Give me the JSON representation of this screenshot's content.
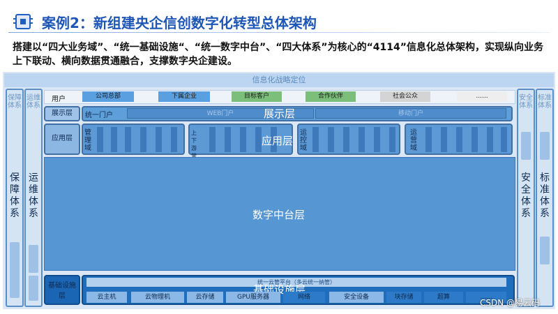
{
  "header": {
    "title": "案例2：新组建央企信创数字化转型总体架构",
    "description": "搭建以“四大业务域”、“统一基础设施“、“统一数字中台”、“四大体系”为核心的“4114”信息化总体架构，实现纵向业务上下联动、横向数据贯通融合，支撑数字央企建设。"
  },
  "banner": "信息化战略定位",
  "left_systems": [
    {
      "faint_label": "保障体系",
      "label": "保障体系"
    },
    {
      "faint_label": "运维体系",
      "label": "运维体系"
    }
  ],
  "right_systems": [
    {
      "faint_label": "安全体系",
      "label": "安全体系"
    },
    {
      "faint_label": "标准体系",
      "label": "标准体系"
    }
  ],
  "users": {
    "label": "用户",
    "items": [
      "公司总部",
      "下属企业",
      "目标客户",
      "合作伙伴",
      "社会公众",
      "......"
    ],
    "colors": [
      "#5a9fe0",
      "#5a9fe0",
      "#7bbf7a",
      "#7bbf7a",
      "#d4d4d4",
      "#eeeeee"
    ]
  },
  "presentation": {
    "label": "展示层",
    "portal": "统一门户",
    "web": "WEB门户",
    "mobile": "移动门户",
    "overlay": "展示层"
  },
  "application": {
    "label": "应用层",
    "overlay": "应用层",
    "domains": [
      "管理域",
      "上下游营销域",
      "运控域",
      "运营域"
    ]
  },
  "data_layer": "数字中台层",
  "infrastructure": {
    "label": "基础设施层",
    "cloud": "统一云管平台（多云统一纳管）",
    "overlay": "基础设施层",
    "items": [
      "云主机",
      "云物理机",
      "云存储",
      "GPU服务器",
      "网络",
      "安全设备",
      "块存储",
      "超算",
      "......"
    ]
  },
  "watermark": "CSDN @易云码"
}
